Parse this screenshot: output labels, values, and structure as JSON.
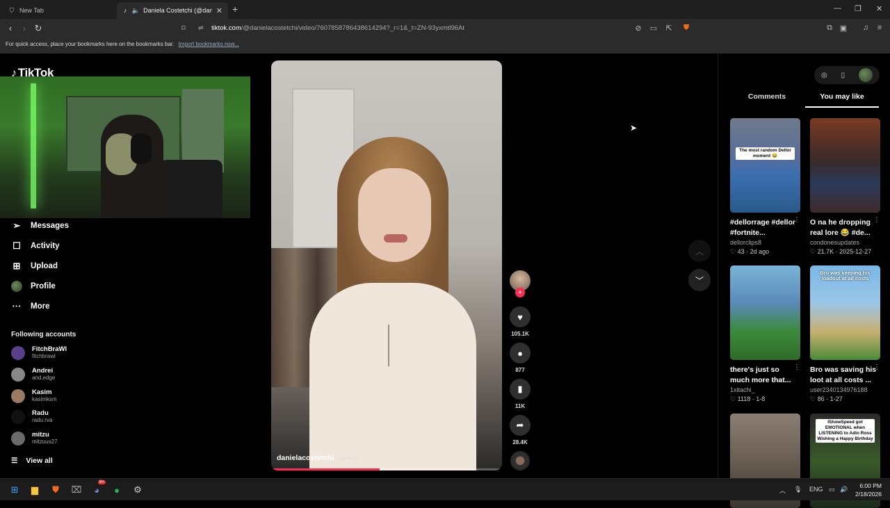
{
  "browser": {
    "tabs": [
      {
        "title": "New Tab"
      },
      {
        "title": "Daniela Costetchi (@daniela...",
        "active": true
      }
    ],
    "url_host": "tiktok.com",
    "url_path": "/@danielacostetchi/video/7607858786438614294?_r=1&_t=ZN-93yxmtl96At",
    "bookmarks_hint": "For quick access, place your bookmarks here on the bookmarks bar.",
    "bookmarks_link": "Import bookmarks now..."
  },
  "tiktok": {
    "logo": "TikTok",
    "nav": [
      {
        "label": "Messages",
        "icon": "paper-plane-icon"
      },
      {
        "label": "Activity",
        "icon": "activity-icon"
      },
      {
        "label": "Upload",
        "icon": "upload-icon"
      },
      {
        "label": "Profile",
        "icon": "avatar"
      },
      {
        "label": "More",
        "icon": "more-icon"
      }
    ],
    "following_title": "Following accounts",
    "following": [
      {
        "name": "FitchBraWl",
        "handle": "fitchbrawl",
        "color": "#5a3f8a"
      },
      {
        "name": "Andrei",
        "handle": "and.edge",
        "color": "#888888"
      },
      {
        "name": "Kasim",
        "handle": "kasimksm",
        "color": "#9a7a62"
      },
      {
        "name": "Radu",
        "handle": "radu.rva",
        "color": "#111111"
      },
      {
        "name": "mitzu",
        "handle": "mitzuus27",
        "color": "#6a6a6a"
      }
    ],
    "view_all": "View all"
  },
  "video": {
    "author": "danielacostetchi",
    "age": "· 1d ago",
    "progress": 0.47,
    "likes": "105.1K",
    "comments": "877",
    "saves": "11K",
    "shares": "28.4K"
  },
  "panel": {
    "tabs": [
      "Comments",
      "You may like"
    ],
    "cards": [
      {
        "caption": "The most random Dellor moment 😂",
        "title": "#dellorrage #dellor #fortnite...",
        "author": "dellorclips8",
        "meta": "♡ 43 · 2d ago",
        "bg": "linear-gradient(180deg,#6f7a8a 0%,#5a6e9a 40%,#3b6fb0 60%,#2a5a8a 100%)"
      },
      {
        "caption": "",
        "title": "O na he dropping real lore 😂 #de...",
        "author": "condonesupdates",
        "meta": "♡ 21.7K · 2025-12-27",
        "bg": "linear-gradient(180deg,#7a3b22 0%,#3a2a2a 45%,#2b3a5a 70%,#402a2a 100%)"
      },
      {
        "caption": "",
        "title": "there's just so much more that...",
        "author": "1xitachi_",
        "meta": "♡ 1118 · 1-8",
        "bg": "linear-gradient(180deg,#7ab4d8 0%,#5a8ab8 40%,#3c8a3a 70%,#2f6a2a 100%)"
      },
      {
        "caption": "Bro was keeping his loadout at all costs",
        "title": "Bro was saving his loot at all costs ...",
        "author": "user2340134976188",
        "meta": "♡ 86 · 1-27",
        "bg": "linear-gradient(180deg,#7ab8e8 0%,#9bc6e8 40%,#c8b070 70%,#4a8a3a 100%)"
      },
      {
        "caption": "",
        "title": "",
        "author": "",
        "meta": "",
        "bg": "linear-gradient(180deg,#8a7f72 0%,#6a5e52 50%,#3a3530 100%)"
      },
      {
        "caption": "IShowSpeed got EMOTIONAL when LISTENING to Adin Ross Wishing a Happy Birthday",
        "title": "",
        "author": "",
        "meta": "",
        "bg": "linear-gradient(180deg,#2a2a2a 0%,#3a5a2a 50%,#1a2a1a 100%)"
      }
    ]
  },
  "taskbar": {
    "lang": "ENG",
    "time": "6:00 PM",
    "date": "2/18/2026",
    "discord_badge": "9+"
  }
}
